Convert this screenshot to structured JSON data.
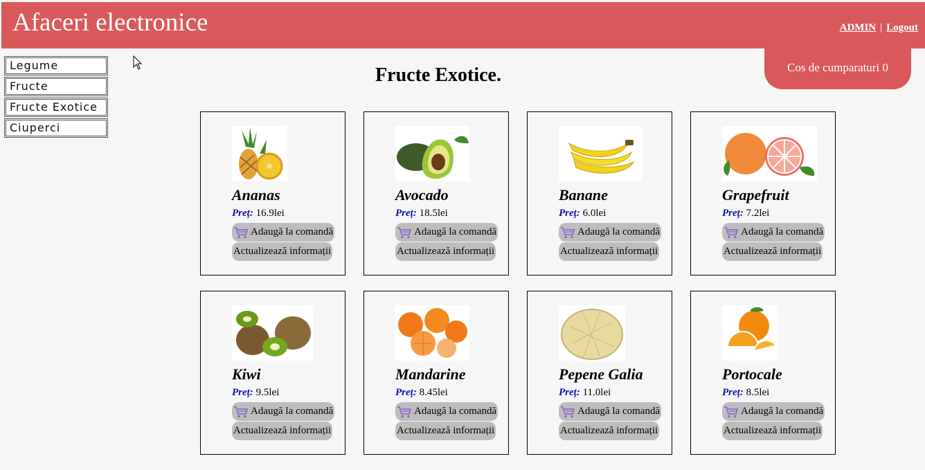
{
  "header": {
    "title": "Afaceri electronice",
    "admin_link": "ADMIN",
    "separator": "|",
    "logout_link": "Logout"
  },
  "cart": {
    "label": "Cos de cumparaturi 0"
  },
  "sidebar": {
    "items": [
      {
        "label": "Legume"
      },
      {
        "label": "Fructe"
      },
      {
        "label": "Fructe Exotice"
      },
      {
        "label": "Ciuperci"
      }
    ]
  },
  "main": {
    "title": "Fructe Exotice."
  },
  "labels": {
    "price": "Preț:",
    "add": "Adaugă la comandă",
    "update": "Actualizează informații"
  },
  "products": [
    {
      "name": "Ananas",
      "price": "16.9lei",
      "icon": "pineapple-image"
    },
    {
      "name": "Avocado",
      "price": "18.5lei",
      "icon": "avocado-image"
    },
    {
      "name": "Banane",
      "price": "6.0lei",
      "icon": "banana-image"
    },
    {
      "name": "Grapefruit",
      "price": "7.2lei",
      "icon": "grapefruit-image"
    },
    {
      "name": "Kiwi",
      "price": "9.5lei",
      "icon": "kiwi-image"
    },
    {
      "name": "Mandarine",
      "price": "8.45lei",
      "icon": "mandarin-image"
    },
    {
      "name": "Pepene Galia",
      "price": "11.0lei",
      "icon": "melon-image"
    },
    {
      "name": "Portocale",
      "price": "8.5lei",
      "icon": "orange-image"
    }
  ],
  "colors": {
    "header": "#d9595b",
    "button": "#bdbdbd",
    "price_label": "#1010b0"
  }
}
